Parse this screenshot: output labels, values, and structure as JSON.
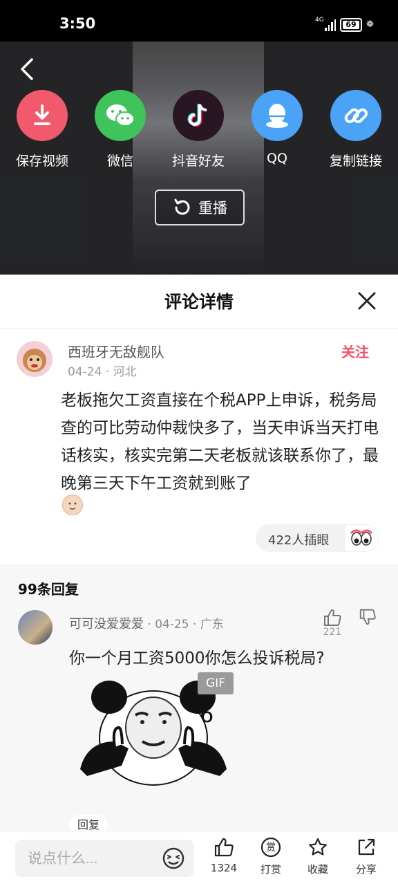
{
  "status_bar": {
    "time": "3:50",
    "network": "4G",
    "battery": "69"
  },
  "video": {
    "share_options": [
      {
        "label": "保存视频",
        "icon": "download-icon",
        "color": "#f15a6c"
      },
      {
        "label": "微信",
        "icon": "wechat-icon",
        "color": "#3fc45c"
      },
      {
        "label": "抖音好友",
        "icon": "douyin-icon",
        "color": "#2a1622"
      },
      {
        "label": "QQ",
        "icon": "qq-icon",
        "color": "#4aa3f7"
      },
      {
        "label": "复制链接",
        "icon": "link-icon",
        "color": "#4aa3f7"
      }
    ],
    "replay_label": "重播"
  },
  "panel": {
    "title": "评论详情"
  },
  "main_comment": {
    "user": "西班牙无敌舰队",
    "meta": "04-24 · 河北",
    "follow_label": "关注",
    "text": "老板拖欠工资直接在个税APP上申诉，税务局查的可比劳动仲裁快多了，当天申诉当天打电话核实，核实完第二天老板就该联系你了，最晚第三天下午工资就到账了",
    "reaction": "422人插眼"
  },
  "replies": {
    "count_label": "99条回复",
    "items": [
      {
        "user": "可可没爱爱爱",
        "meta": " · 04-25 · 广东",
        "likes": "221",
        "text": "你一个月工资5000你怎么投诉税局?",
        "gif_badge": "GIF",
        "gif_caption": "6",
        "reply_label": "回复"
      }
    ]
  },
  "bottom_bar": {
    "input_placeholder": "说点什么...",
    "actions": [
      {
        "label": "1324",
        "icon": "thumbs-up-icon"
      },
      {
        "label": "打赏",
        "icon": "reward-icon"
      },
      {
        "label": "收藏",
        "icon": "star-icon"
      },
      {
        "label": "分享",
        "icon": "share-icon"
      }
    ]
  },
  "colors": {
    "accent": "#f3506b"
  }
}
